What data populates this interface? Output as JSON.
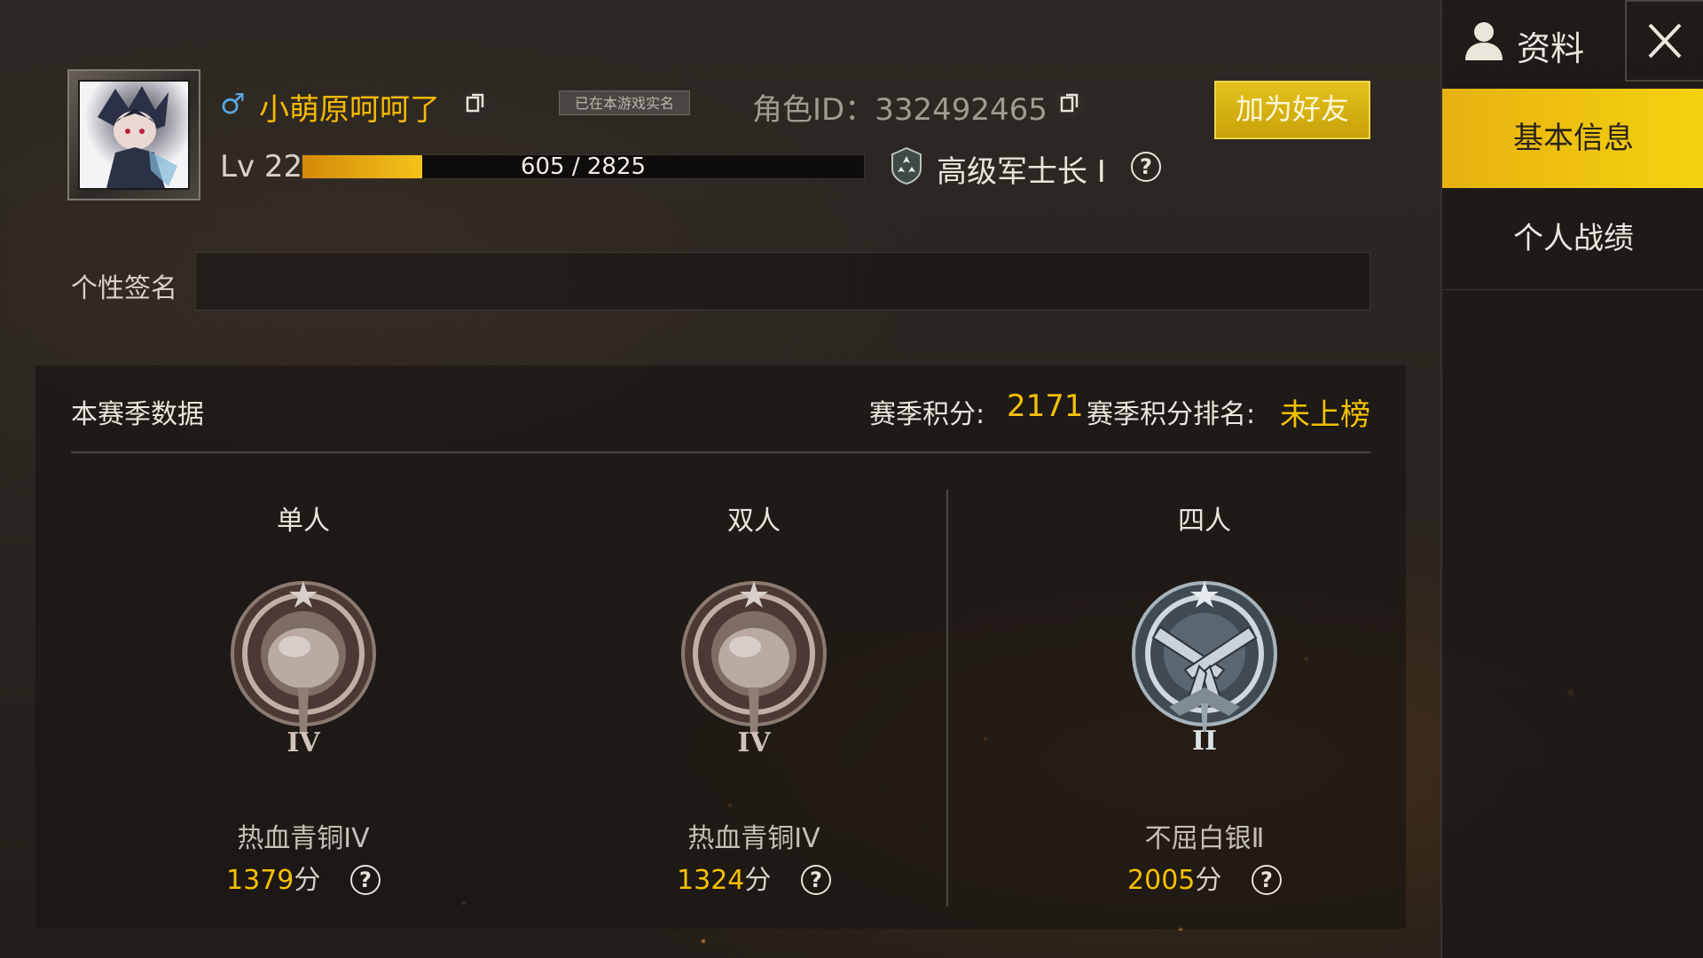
{
  "profile": {
    "gender_symbol": "♂",
    "name": "小萌原呵呵了",
    "verified_badge": "已在本游戏实名",
    "role_id_label": "角色ID：332492465",
    "add_friend_label": "加为好友",
    "level_label": "Lv 22",
    "xp_text": "605 / 2825",
    "xp_progress": 0.214,
    "rank_title": "高级军士长 I",
    "help_glyph": "?"
  },
  "signature": {
    "label": "个性签名",
    "value": ""
  },
  "season": {
    "title": "本赛季数据",
    "score_label": "赛季积分:",
    "score_value": "2171",
    "rank_label": "赛季积分排名:",
    "rank_value": "未上榜",
    "modes": [
      {
        "title": "单人",
        "tier": "热血青铜IV",
        "score": "1379",
        "unit": "分",
        "medal": "pan-medal-icon",
        "numeral": "IV"
      },
      {
        "title": "双人",
        "tier": "热血青铜IV",
        "score": "1324",
        "unit": "分",
        "medal": "pan-medal-icon",
        "numeral": "IV"
      },
      {
        "title": "四人",
        "tier": "不屈白银Ⅱ",
        "score": "2005",
        "unit": "分",
        "medal": "pistol-medal-icon",
        "numeral": "II"
      }
    ]
  },
  "sidebar": {
    "profile_tab": "资料",
    "menu": [
      "基本信息",
      "个人战绩"
    ]
  },
  "colors": {
    "accent_gold": "#f5c000",
    "active_menu": "#f0c80e",
    "gender_blue": "#58a6e0"
  }
}
